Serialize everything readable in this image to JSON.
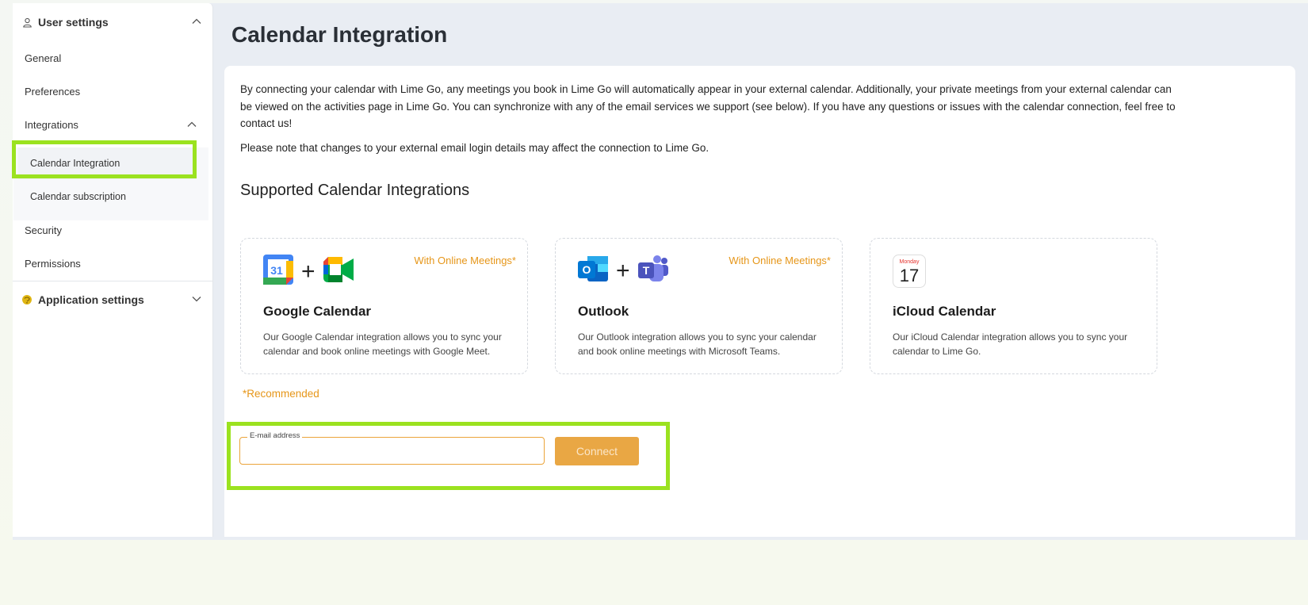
{
  "sidebar": {
    "user_settings_label": "User settings",
    "items": {
      "general": "General",
      "preferences": "Preferences",
      "integrations": "Integrations",
      "calendar_integration": "Calendar Integration",
      "calendar_subscription": "Calendar subscription",
      "security": "Security",
      "permissions": "Permissions"
    },
    "application_settings_label": "Application settings"
  },
  "page": {
    "title": "Calendar Integration",
    "intro": "By connecting your calendar with Lime Go, any meetings you book in Lime Go will automatically appear in your external calendar. Additionally, your private meetings from your external calendar can be viewed on the activities page in Lime Go. You can synchronize with any of the email services we support (see below). If you have any questions or issues with the calendar connection, feel free to contact us!",
    "note": "Please note that changes to your external email login details may affect the connection to Lime Go.",
    "supported_heading": "Supported Calendar Integrations",
    "recommended": "*Recommended"
  },
  "cards": {
    "google": {
      "badge": "With Online Meetings*",
      "name": "Google Calendar",
      "description": "Our Google Calendar integration allows you to sync your calendar and book online meetings with Google Meet.",
      "logo_text": "31"
    },
    "outlook": {
      "badge": "With Online Meetings*",
      "name": "Outlook",
      "description": "Our Outlook integration allows you to sync your calendar and book online meetings with Microsoft Teams.",
      "logo_text": "O",
      "teams_text": "T"
    },
    "icloud": {
      "name": "iCloud Calendar",
      "description": "Our iCloud Calendar integration allows you to sync your calendar to Lime Go.",
      "logo_day": "Monday",
      "logo_date": "17"
    }
  },
  "form": {
    "email_label": "E-mail address",
    "email_value": "",
    "connect_label": "Connect"
  },
  "colors": {
    "accent_orange": "#e69619",
    "highlight_green": "#9be21f",
    "connect_button": "#e9a744"
  },
  "icons": [
    "user-icon",
    "chevron-up-icon",
    "chevron-down-icon",
    "application-settings-icon",
    "google-calendar-logo",
    "google-meet-logo",
    "outlook-logo",
    "teams-logo",
    "icloud-calendar-logo"
  ]
}
